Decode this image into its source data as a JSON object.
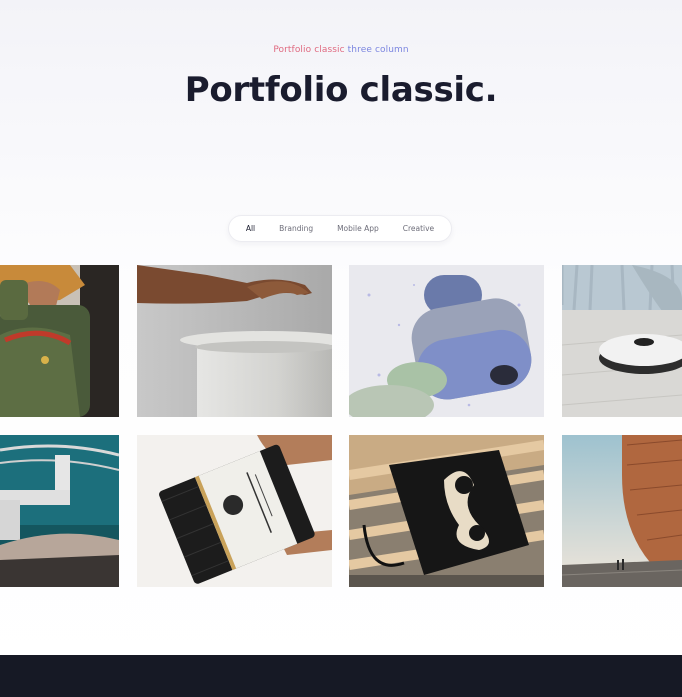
{
  "header": {
    "subtitle_part1": "Portfolio classic",
    "subtitle_part2": "three column",
    "title": "Portfolio classic."
  },
  "filters": [
    {
      "label": "All",
      "active": true
    },
    {
      "label": "Branding",
      "active": false
    },
    {
      "label": "Mobile App",
      "active": false
    },
    {
      "label": "Creative",
      "active": false
    }
  ],
  "colors": {
    "title": "#1a1c2e",
    "subtitle_accent_pink": "#e06a80",
    "subtitle_accent_blue": "#7c86e0",
    "footer_bg": "#161925"
  },
  "portfolio_items": [
    {
      "name": "backpack",
      "icon": "green-backpack-photo"
    },
    {
      "name": "white-stool",
      "icon": "hand-white-stool-photo"
    },
    {
      "name": "speaker",
      "icon": "blue-speaker-3d-render"
    },
    {
      "name": "robot-vacuum",
      "icon": "robot-vacuum-photo"
    },
    {
      "name": "teal-chair",
      "icon": "teal-chair-photo"
    },
    {
      "name": "packaging",
      "icon": "black-packaging-photo"
    },
    {
      "name": "tote-bag",
      "icon": "black-tote-bag-photo"
    },
    {
      "name": "architecture",
      "icon": "copper-building-photo"
    }
  ]
}
